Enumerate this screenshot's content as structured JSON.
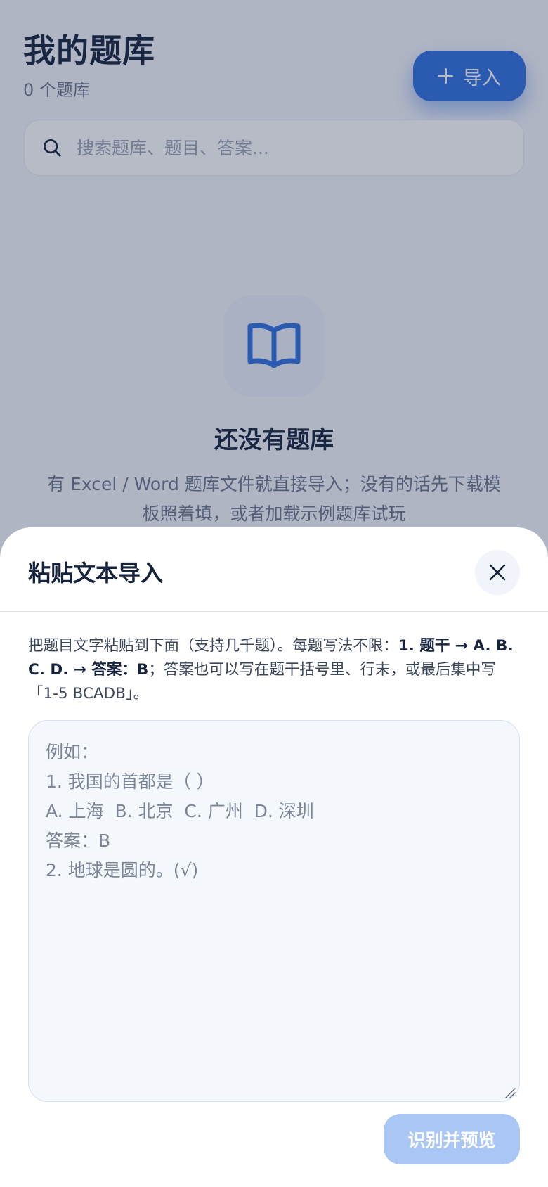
{
  "page": {
    "title": "我的题库",
    "count_text": "0 个题库",
    "import_label": "导入",
    "search_placeholder": "搜索题库、题目、答案...",
    "empty_title": "还没有题库",
    "empty_desc": "有 Excel / Word 题库文件就直接导入；没有的话先下载模板照着填，或者加载示例题库试玩"
  },
  "sheet": {
    "title": "粘贴文本导入",
    "help": {
      "part1": "把题目文字粘贴到下面（支持几千题）。每题写法不限：",
      "bold1": "1. 题干 → A. B. C. D. → 答案：B",
      "part2": "；答案也可以写在题干括号里、行末，或最后集中写「1-5 BCADB」。"
    },
    "paste_placeholder": "例如：\n1. 我国的首都是（ ）\nA. 上海  B. 北京  C. 广州  D. 深圳\n答案：B\n2. 地球是圆的。(√)",
    "submit_label": "识别并预览"
  },
  "colors": {
    "accent": "#2f6fe0",
    "disabled_button": "#a9c6f4",
    "title_text": "#16233d",
    "muted_text": "#6b778c"
  },
  "icons": {
    "import": "plus-icon",
    "search": "search-icon",
    "empty": "book-open-icon",
    "close": "close-icon"
  }
}
